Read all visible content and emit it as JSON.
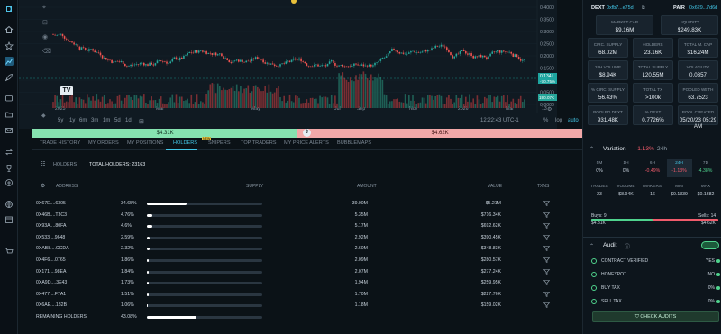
{
  "sidebar": {
    "icons": [
      "logo-icon",
      "home-icon",
      "star-icon",
      "chart-icon",
      "rocket-icon",
      "wallet-icon",
      "folder-icon",
      "mail-icon",
      "list-icon",
      "swap-icon",
      "trophy-icon",
      "gift-icon",
      "globe-icon",
      "calendar-icon",
      "cart-icon"
    ]
  },
  "chart": {
    "price_ticks": [
      "0.4000",
      "0.3500",
      "0.3000",
      "0.2500",
      "0.2000",
      "0.1500",
      "0.1000",
      "0.0500",
      "0.0000"
    ],
    "current_price": "0.1341",
    "current_change": "-70.75%",
    "volume_tag": "190.07K",
    "x_labels": [
      "2025",
      "Mar",
      "May",
      "Jul",
      "Sep",
      "Nov",
      "2026",
      "Mar",
      "13"
    ],
    "timeframes": [
      "5y",
      "1y",
      "6m",
      "3m",
      "1m",
      "5d",
      "1d"
    ],
    "clock": "12:22:43 UTC-1",
    "pct_label": "%",
    "log_label": "log",
    "auto_label": "auto",
    "colors": {
      "up": "#26a69a",
      "down": "#ef5350"
    }
  },
  "buysell": {
    "buy": "$4.31K",
    "sell": "$4.62K",
    "buy_fraction": 0.4826
  },
  "tabs": [
    {
      "label": "TRADE HISTORY",
      "active": false
    },
    {
      "label": "MY ORDERS",
      "active": false
    },
    {
      "label": "MY POSITIONS",
      "active": false
    },
    {
      "label": "HOLDERS",
      "active": true
    },
    {
      "label": "SNIPERS",
      "active": false,
      "badge": "NEW"
    },
    {
      "label": "TOP TRADERS",
      "active": false
    },
    {
      "label": "MY PRICE ALERTS",
      "active": false
    },
    {
      "label": "BUBBLEMAPS",
      "active": false
    }
  ],
  "holders": {
    "title": "HOLDERS",
    "total": "TOTAL HOLDERS: 23163",
    "columns": {
      "address": "ADDRESS",
      "supply": "SUPPLY",
      "amount": "AMOUNT",
      "value": "VALUE",
      "txns": "TXNS"
    },
    "rows": [
      {
        "address": "0X67E....6305",
        "pct": "34.65%",
        "fraction": 0.3465,
        "amount": "39.00M",
        "value": "$5.21M"
      },
      {
        "address": "0X46B....T3C3",
        "pct": "4.76%",
        "fraction": 0.0476,
        "amount": "5.35M",
        "value": "$716.34K"
      },
      {
        "address": "0X93A....80FA",
        "pct": "4.6%",
        "fraction": 0.046,
        "amount": "5.17M",
        "value": "$692.62K"
      },
      {
        "address": "0X533....9648",
        "pct": "2.59%",
        "fraction": 0.0259,
        "amount": "2.92M",
        "value": "$390.45K"
      },
      {
        "address": "0XAB8....CCDA",
        "pct": "2.32%",
        "fraction": 0.0232,
        "amount": "2.60M",
        "value": "$348.83K"
      },
      {
        "address": "0X4F6....0765",
        "pct": "1.86%",
        "fraction": 0.0186,
        "amount": "2.09M",
        "value": "$280.57K"
      },
      {
        "address": "0X171....98EA",
        "pct": "1.84%",
        "fraction": 0.0184,
        "amount": "2.07M",
        "value": "$277.24K"
      },
      {
        "address": "0XA9D....3E43",
        "pct": "1.73%",
        "fraction": 0.0173,
        "amount": "1.94M",
        "value": "$259.95K"
      },
      {
        "address": "0X477....F7A1",
        "pct": "1.51%",
        "fraction": 0.0151,
        "amount": "1.70M",
        "value": "$227.76K"
      },
      {
        "address": "0X6AE....182B",
        "pct": "1.06%",
        "fraction": 0.0106,
        "amount": "1.18M",
        "value": "$159.02K"
      },
      {
        "address": "REMAINING HOLDERS",
        "pct": "43.08%",
        "fraction": 0.4308,
        "amount": "",
        "value": ""
      }
    ]
  },
  "right": {
    "dext_label": "DEXT",
    "dext_addr": "0xfb7...e75d",
    "pair_label": "PAIR",
    "pair_addr": "0x629...7d6d",
    "stats": [
      {
        "label": "MARKET CAP",
        "value": "$9.16M"
      },
      {
        "label": "LIQUIDITY",
        "value": "$249.83K"
      },
      {
        "label": "CIRC. SUPPLY",
        "value": "68.02M"
      },
      {
        "label": "HOLDERS",
        "value": "23.16K"
      },
      {
        "label": "TOTAL M. CAP",
        "value": "$16.24M"
      },
      {
        "label": "24H VOLUME",
        "value": "$8.94K"
      },
      {
        "label": "TOTAL SUPPLY",
        "value": "120.55M"
      },
      {
        "label": "VOLATILITY",
        "value": "0.0357"
      },
      {
        "label": "% CIRC. SUPPLY",
        "value": "56.43%"
      },
      {
        "label": "TOTAL TX",
        "value": ">100k"
      },
      {
        "label": "POOLED WETH",
        "value": "63.7523"
      },
      {
        "label": "POOLED DEXT",
        "value": "931.48K"
      },
      {
        "label": "% DEXT",
        "value": "0.7726%"
      },
      {
        "label": "POOL CREATED",
        "value": "05/20/23 05:29 AM"
      }
    ],
    "variation": {
      "title": "Variation",
      "change": "-1.13%",
      "period": "24h",
      "cols": [
        {
          "label": "5M",
          "value": "0%"
        },
        {
          "label": "1H",
          "value": "0%"
        },
        {
          "label": "6H",
          "value": "-0.49%"
        },
        {
          "label": "24H",
          "value": "-1.13%"
        },
        {
          "label": "7D",
          "value": "4.38%"
        }
      ],
      "trade_cols": [
        {
          "label": "TRADES",
          "value": "23"
        },
        {
          "label": "VOLUME",
          "value": "$8.94K"
        },
        {
          "label": "MAKERS",
          "value": "16"
        },
        {
          "label": "MIN",
          "value": "$0.1339"
        },
        {
          "label": "MAX",
          "value": "$0.1382"
        }
      ],
      "buys": "Buys: 9",
      "buys_val": "$4.31K",
      "sells": "Sells: 14",
      "sells_val": "$4.62K",
      "buy_fraction": 0.4826
    },
    "audit": {
      "title": "Audit",
      "rows": [
        {
          "label": "CONTRACT VERIFIED",
          "value": "YES"
        },
        {
          "label": "HONEYPOT",
          "value": "NO"
        },
        {
          "label": "BUY TAX",
          "value": "0%"
        },
        {
          "label": "SELL TAX",
          "value": "0%"
        }
      ],
      "button": "CHECK AUDITS"
    }
  }
}
